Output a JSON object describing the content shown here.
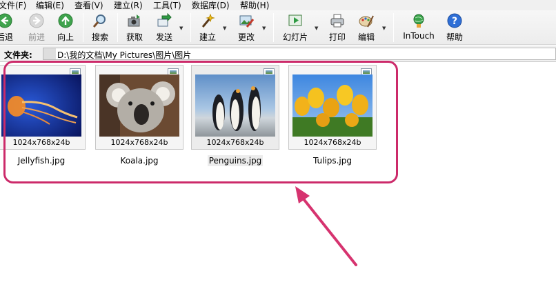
{
  "menu": [
    "文件(F)",
    "编辑(E)",
    "查看(V)",
    "建立(R)",
    "工具(T)",
    "数据库(D)",
    "帮助(H)"
  ],
  "toolbar": {
    "back": "后退",
    "forward": "前进",
    "up": "向上",
    "search": "搜索",
    "acquire": "获取",
    "send": "发送",
    "create": "建立",
    "modify": "更改",
    "slideshow": "幻灯片",
    "print": "打印",
    "edit": "编辑",
    "intouch": "InTouch",
    "help": "帮助"
  },
  "folderbar": {
    "label": "文件夹:",
    "path": "D:\\我的文档\\My Pictures\\图片\\图片"
  },
  "thumbnails": [
    {
      "name": "Jellyfish.jpg",
      "dimensions": "1024x768x24b"
    },
    {
      "name": "Koala.jpg",
      "dimensions": "1024x768x24b"
    },
    {
      "name": "Penguins.jpg",
      "dimensions": "1024x768x24b"
    },
    {
      "name": "Tulips.jpg",
      "dimensions": "1024x768x24b"
    }
  ],
  "colors": {
    "annotation": "#cc2a6a"
  }
}
